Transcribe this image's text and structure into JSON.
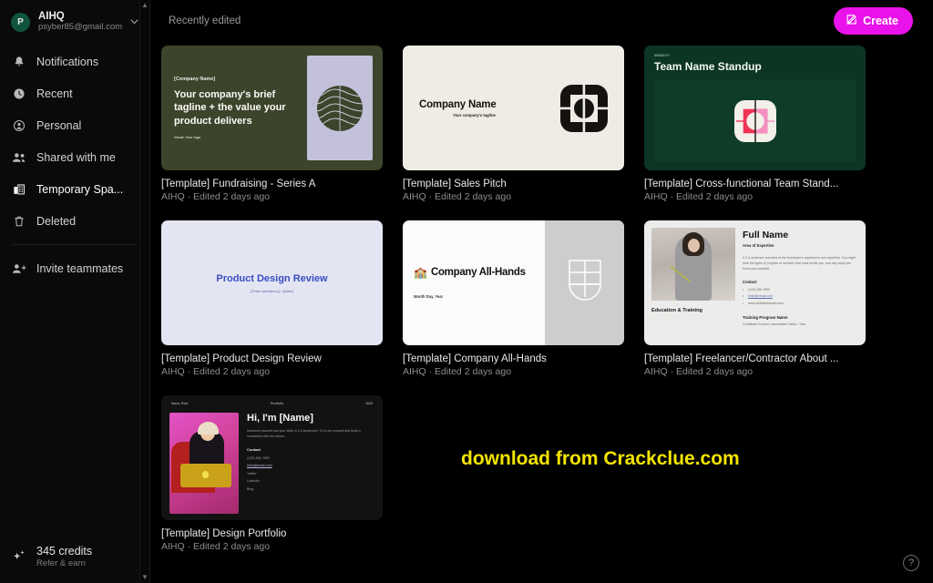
{
  "sidebar": {
    "profile": {
      "avatar_letter": "P",
      "name": "AIHQ",
      "email": "psyber85@gmail.com",
      "chevron": "chevron-down"
    },
    "items": [
      {
        "label": "Notifications",
        "icon": "bell-icon",
        "active": false
      },
      {
        "label": "Recent",
        "icon": "clock-icon",
        "active": false
      },
      {
        "label": "Personal",
        "icon": "person-circle-icon",
        "active": false
      },
      {
        "label": "Shared with me",
        "icon": "people-icon",
        "active": false
      },
      {
        "label": "Temporary Spa...",
        "icon": "building-icon",
        "active": true
      },
      {
        "label": "Deleted",
        "icon": "trash-icon",
        "active": false
      }
    ],
    "invite": {
      "label": "Invite teammates",
      "icon": "person-add-icon"
    },
    "credits": {
      "amount": "345 credits",
      "sub": "Refer & earn",
      "icon": "sparkle-icon"
    },
    "scrollbar": {
      "up": "▲",
      "down": "▼"
    }
  },
  "topbar": {
    "title": "Recently edited",
    "create_label": "Create",
    "create_icon": "edit-pencil-icon",
    "create_color": "#ea12ea"
  },
  "cards": [
    {
      "title": "[Template] Fundraising - Series A",
      "subtitle": "AIHQ · Edited 2 days ago",
      "thumb": {
        "company": "[Company Name]",
        "tagline": "Your company's brief tagline + the value your product delivers",
        "visual_note": "Visual: Your logo",
        "bg": "#3d442c",
        "panel": "#c3c0da"
      }
    },
    {
      "title": "[Template] Sales Pitch",
      "subtitle": "AIHQ · Edited 2 days ago",
      "thumb": {
        "company": "Company Name",
        "tagline": "Your company's tagline",
        "bg": "#efece6",
        "logo": "#151310"
      }
    },
    {
      "title": "[Template] Cross-functional Team Stand...",
      "subtitle": "AIHQ · Edited 2 days ago",
      "thumb": {
        "kicker": "MM/DD/YY",
        "title": "Team Name Standup",
        "bg": "#0c3524",
        "logo": "#ef3355"
      }
    },
    {
      "title": "[Template] Product Design Review",
      "subtitle": "AIHQ · Edited 2 days ago",
      "thumb": {
        "title": "Product Design Review",
        "subtitle": "[Team members] • [Date]",
        "bg": "#e4e5f3",
        "accent": "#3a4cc0"
      }
    },
    {
      "title": "[Template] Company All-Hands",
      "subtitle": "AIHQ · Edited 2 days ago",
      "thumb": {
        "emoji": "🏫",
        "title": "Company All-Hands",
        "date": "Month Day, Year",
        "bg": "#fbfbfb",
        "panel": "#cdcdcd"
      }
    },
    {
      "title": "[Template] Freelancer/Contractor About ...",
      "subtitle": "AIHQ · Edited 2 days ago",
      "thumb": {
        "name": "Full Name",
        "area": "Area of Expertise",
        "paragraph": "A 2-3 sentence overview of the freelancer's experience and expertise. You might note the types of projects or services that most excite you, and any ways you focus your practice.",
        "contact_heading": "Contact",
        "contact": [
          "(123) 456-7890",
          "hello@email.com",
          "www.websitedomain.com"
        ],
        "education_label": "Education & Training",
        "training_name": "Training Program Name",
        "training_sub": "Certificate Earned • Associated Skills • Year",
        "bg": "#ececea"
      }
    },
    {
      "title": "[Template] Design Portfolio",
      "subtitle": "AIHQ · Edited 2 days ago",
      "thumb": {
        "bar_left": "Name, Role",
        "bar_center": "Portfolio",
        "bar_right": "2023",
        "heading": "Hi, I'm [Name]",
        "paragraph": "Introduce yourself and your skills in 2-3 sentences. Try to be yourself and build a connection with the viewer.",
        "contact_heading": "Contact",
        "contact": [
          "(123) 456-7890",
          "hello@email.com",
          "Twitter",
          "LinkedIn",
          "Blog"
        ],
        "bg": "#121212"
      }
    }
  ],
  "watermark": {
    "text": "download from Crackclue.com",
    "color": "#f5e400"
  },
  "help": {
    "glyph": "?"
  }
}
